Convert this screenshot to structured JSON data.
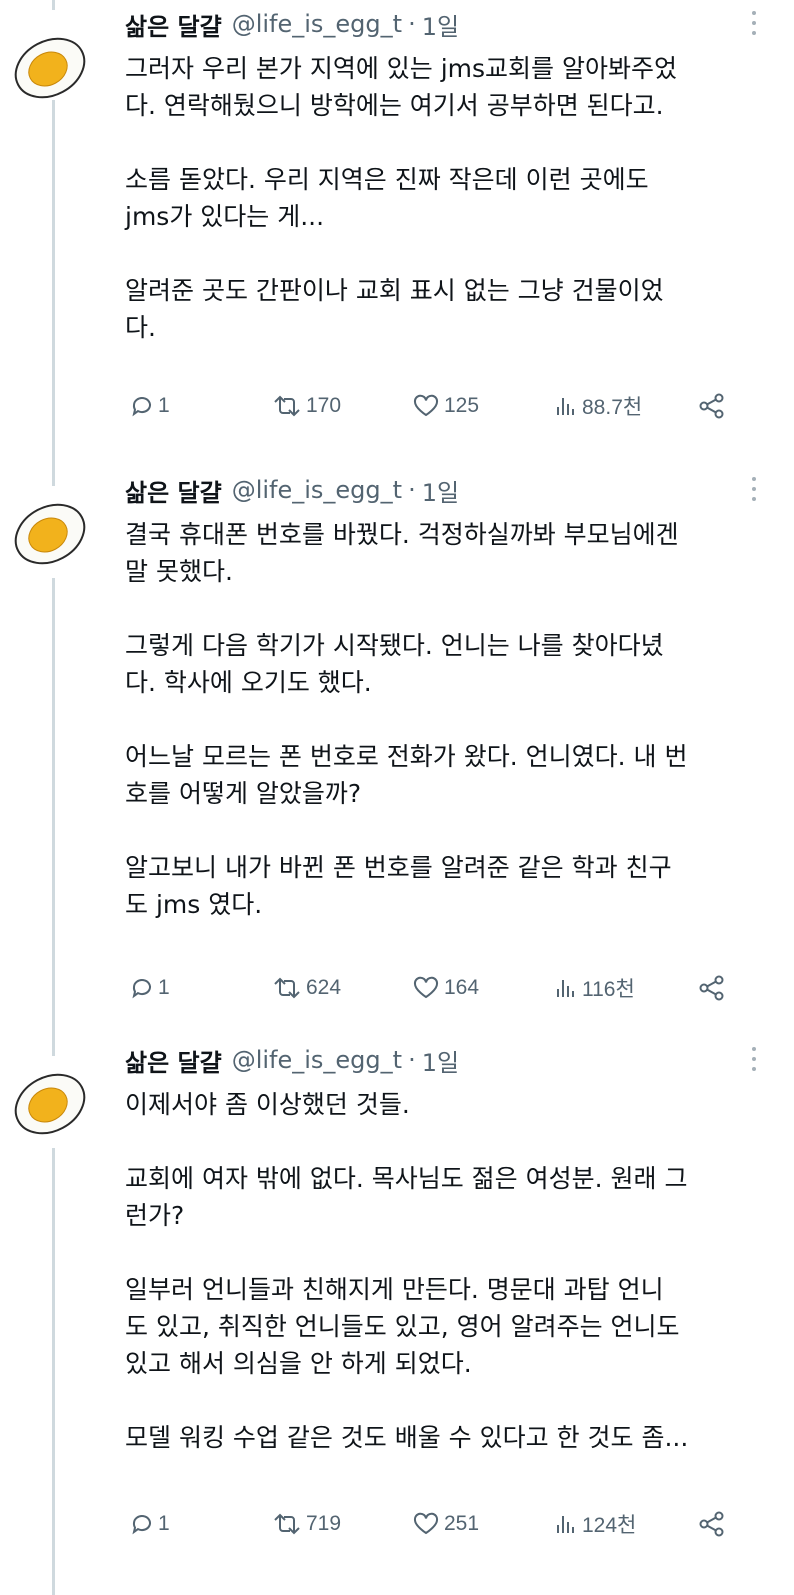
{
  "tweets": [
    {
      "author": {
        "name": "삶은 달걀",
        "handle": "@life_is_egg_t",
        "avatar": "boiled-egg-avatar"
      },
      "separator": "·",
      "time": "1일",
      "paragraphs": [
        "그러자 우리 본가 지역에 있는 jms교회를 알아봐주었\n다. 연락해뒀으니 방학에는 여기서 공부하면 된다고.",
        "소름 돋았다. 우리 지역은 진짜 작은데 이런 곳에도\njms가 있다는 게...",
        "알려준 곳도 간판이나 교회 표시 없는 그냥 건물이었\n다."
      ],
      "actions": {
        "replies": "1",
        "retweets": "170",
        "likes": "125",
        "views": "88.7천"
      }
    },
    {
      "author": {
        "name": "삶은 달걀",
        "handle": "@life_is_egg_t",
        "avatar": "boiled-egg-avatar"
      },
      "separator": "·",
      "time": "1일",
      "paragraphs": [
        "결국 휴대폰 번호를 바꿨다. 걱정하실까봐 부모님에겐\n말 못했다.",
        "그렇게 다음 학기가 시작됐다. 언니는 나를 찾아다녔\n다. 학사에 오기도 했다.",
        "어느날 모르는 폰 번호로 전화가 왔다. 언니였다. 내 번\n호를 어떻게 알았을까?",
        "알고보니 내가 바뀐 폰 번호를 알려준 같은 학과 친구\n도 jms 였다."
      ],
      "actions": {
        "replies": "1",
        "retweets": "624",
        "likes": "164",
        "views": "116천"
      }
    },
    {
      "author": {
        "name": "삶은 달걀",
        "handle": "@life_is_egg_t",
        "avatar": "boiled-egg-avatar"
      },
      "separator": "·",
      "time": "1일",
      "paragraphs": [
        "이제서야 좀 이상했던 것들.",
        "교회에 여자 밖에 없다. 목사님도 젊은 여성분. 원래 그\n런가?",
        "일부러 언니들과 친해지게 만든다. 명문대 과탑 언니\n도 있고, 취직한 언니들도 있고, 영어 알려주는 언니도\n있고 해서 의심을 안 하게 되었다.",
        "모델 워킹 수업 같은 것도 배울 수 있다고 한 것도 좀..."
      ],
      "actions": {
        "replies": "1",
        "retweets": "719",
        "likes": "251",
        "views": "124천"
      }
    }
  ],
  "icons": {
    "reply": "reply-icon",
    "retweet": "retweet-icon",
    "like": "heart-icon",
    "views": "views-chart-icon",
    "share": "share-icon",
    "more": "more-options-icon"
  },
  "colors": {
    "text": "#0f1419",
    "secondary": "#536471",
    "thread_line": "#cfd9de",
    "egg_yolk": "#f2b21c",
    "egg_white": "#fbfbf7"
  }
}
